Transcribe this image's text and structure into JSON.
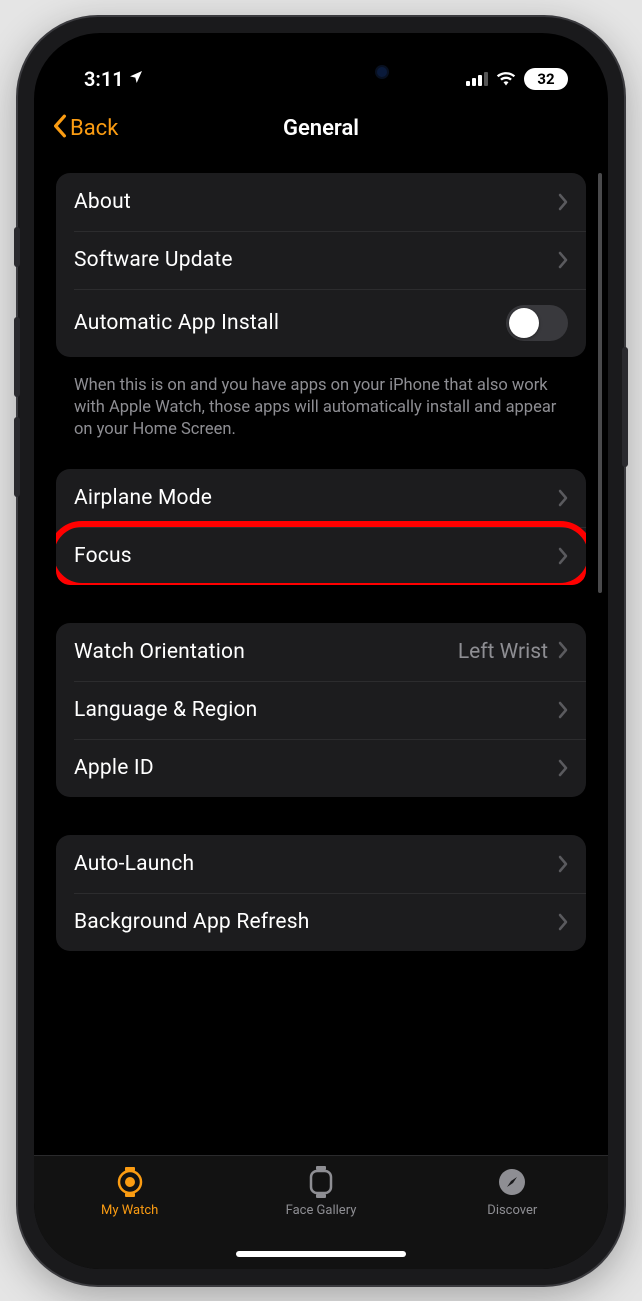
{
  "status": {
    "time": "3:11",
    "battery": "32"
  },
  "nav": {
    "back": "Back",
    "title": "General"
  },
  "group1": {
    "about": "About",
    "software_update": "Software Update",
    "auto_install": "Automatic App Install"
  },
  "footer1": "When this is on and you have apps on your iPhone that also work with Apple Watch, those apps will automatically install and appear on your Home Screen.",
  "group2": {
    "airplane": "Airplane Mode",
    "focus": "Focus"
  },
  "group3": {
    "orientation": "Watch Orientation",
    "orientation_value": "Left Wrist",
    "language": "Language & Region",
    "apple_id": "Apple ID"
  },
  "group4": {
    "auto_launch": "Auto-Launch",
    "bg_refresh": "Background App Refresh"
  },
  "tabs": {
    "my_watch": "My Watch",
    "face_gallery": "Face Gallery",
    "discover": "Discover"
  }
}
